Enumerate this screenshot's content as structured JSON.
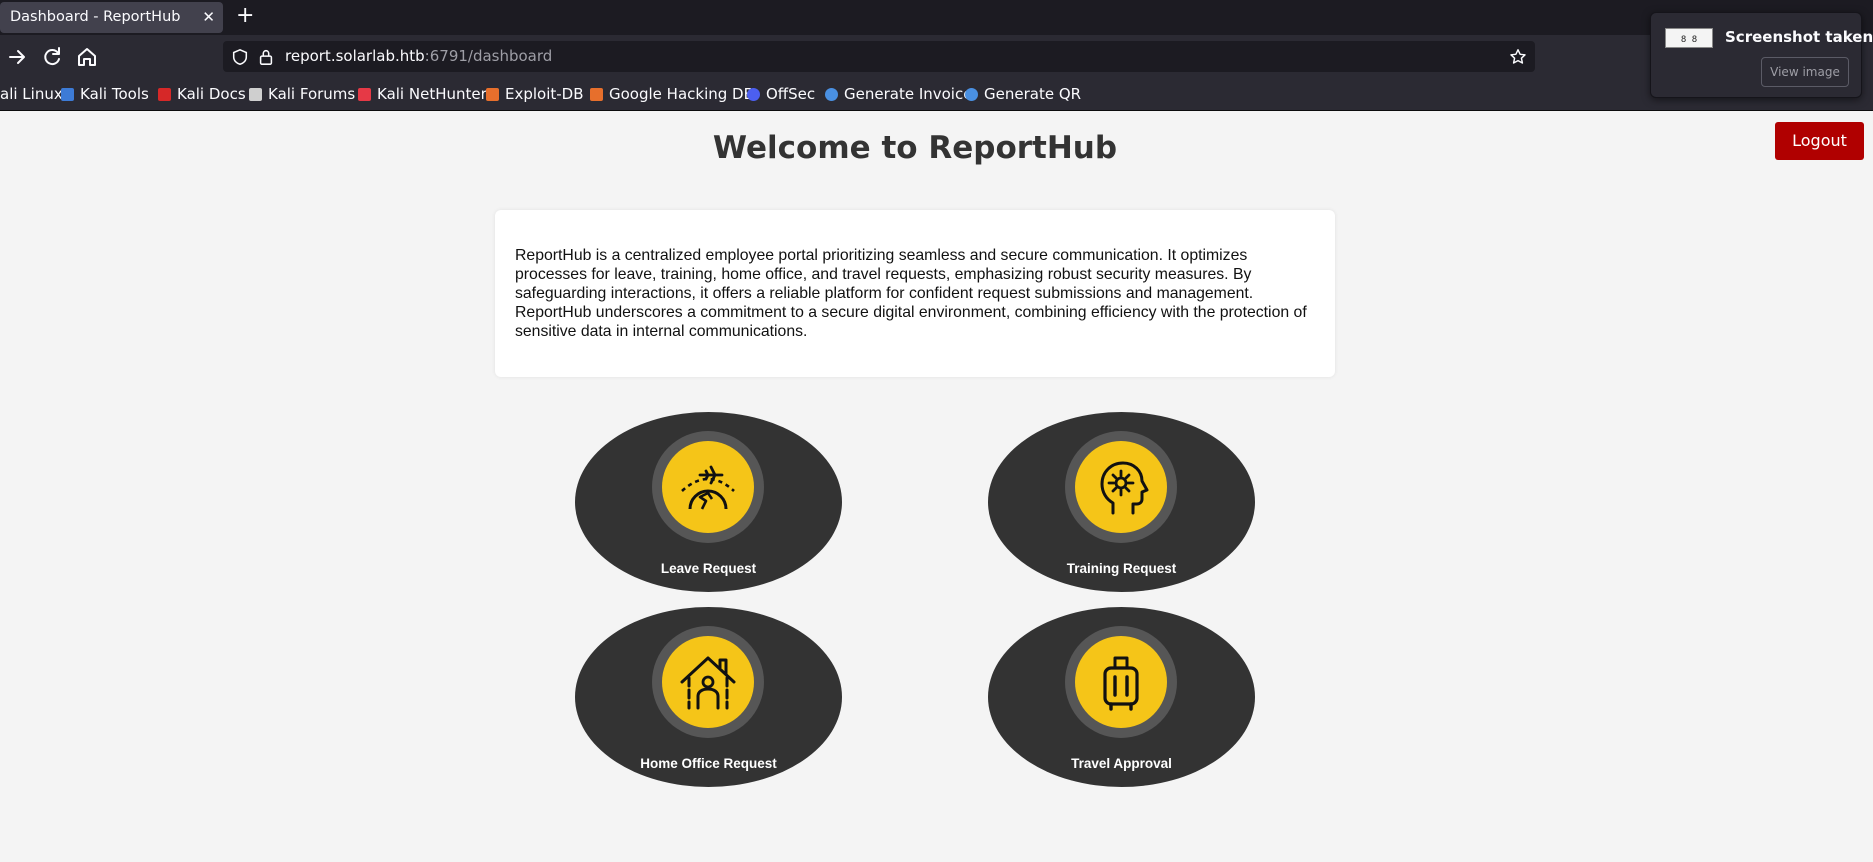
{
  "browser": {
    "tab_title": "Dashboard - ReportHub",
    "tab_close": "✕",
    "new_tab": "+",
    "url_host": "report.solarlab.htb",
    "url_rest": ":6791/dashboard"
  },
  "bookmarks": [
    {
      "label": "ali Linux",
      "icon_color": "#2b2a33"
    },
    {
      "label": "Kali Tools",
      "icon_color": "#3d7bd6"
    },
    {
      "label": "Kali Docs",
      "icon_color": "#d62828"
    },
    {
      "label": "Kali Forums",
      "icon_color": "#cfcfcf"
    },
    {
      "label": "Kali NetHunter",
      "icon_color": "#e63946"
    },
    {
      "label": "Exploit-DB",
      "icon_color": "#e76f2c"
    },
    {
      "label": "Google Hacking DB",
      "icon_color": "#e76f2c"
    },
    {
      "label": "OffSec",
      "icon_color": "#4c5ff0"
    },
    {
      "label": "Generate Invoice",
      "icon_color": "#4a90e2"
    },
    {
      "label": "Generate QR",
      "icon_color": "#4a90e2"
    }
  ],
  "toast": {
    "thumb_text": "8 8",
    "title": "Screenshot taken",
    "button": "View image"
  },
  "page": {
    "title": "Welcome to ReportHub",
    "logout_label": "Logout",
    "intro": "ReportHub is a centralized employee portal prioritizing seamless and secure communication. It optimizes processes for leave, training, home office, and travel requests, emphasizing robust security measures. By safeguarding interactions, it offers a reliable platform for confident request submissions and management. ReportHub underscores a commitment to a secure digital environment, combining efficiency with the protection of sensitive data in internal communications.",
    "tiles": [
      {
        "label": "Leave Request",
        "icon": "plane-globe-icon"
      },
      {
        "label": "Training Request",
        "icon": "head-gear-icon"
      },
      {
        "label": "Home Office Request",
        "icon": "house-person-icon"
      },
      {
        "label": "Travel Approval",
        "icon": "luggage-icon"
      }
    ]
  },
  "colors": {
    "accent": "#f5c518",
    "tile": "#333333",
    "logout": "#b00000"
  }
}
